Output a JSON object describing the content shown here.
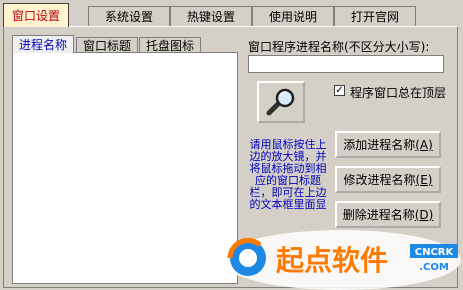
{
  "tabs": [
    {
      "label": "窗口设置",
      "active": true
    },
    {
      "label": "系统设置"
    },
    {
      "label": "热键设置"
    },
    {
      "label": "使用说明"
    },
    {
      "label": "打开官网"
    }
  ],
  "subtabs": [
    {
      "label": "进程名称",
      "active": true
    },
    {
      "label": "窗口标题"
    },
    {
      "label": "托盘图标"
    }
  ],
  "process_label": "窗口程序进程名称(不区分大小写):",
  "process_value": "",
  "topmost_label": "程序窗口总在顶层",
  "topmost_checked": "✓",
  "hint_text": "请用鼠标按住上边的放大镜，并将鼠标拖动到相应的窗口标题栏，即可在上边的文本框里面显",
  "buttons": {
    "add": {
      "label": "添加进程名称",
      "key": "(A)"
    },
    "modify": {
      "label": "修改进程名称",
      "key": "(E)"
    },
    "delete": {
      "label": "删除进程名称",
      "key": "(D)"
    }
  },
  "watermark": {
    "text": "起点软件",
    "domain": "CNCRK",
    "tld": ".COM"
  },
  "colors": {
    "active_tab_text": "#c00000",
    "hint_text": "#0000c0",
    "watermark_orange": "#ff7a00",
    "watermark_blue": "#1e88e5"
  }
}
